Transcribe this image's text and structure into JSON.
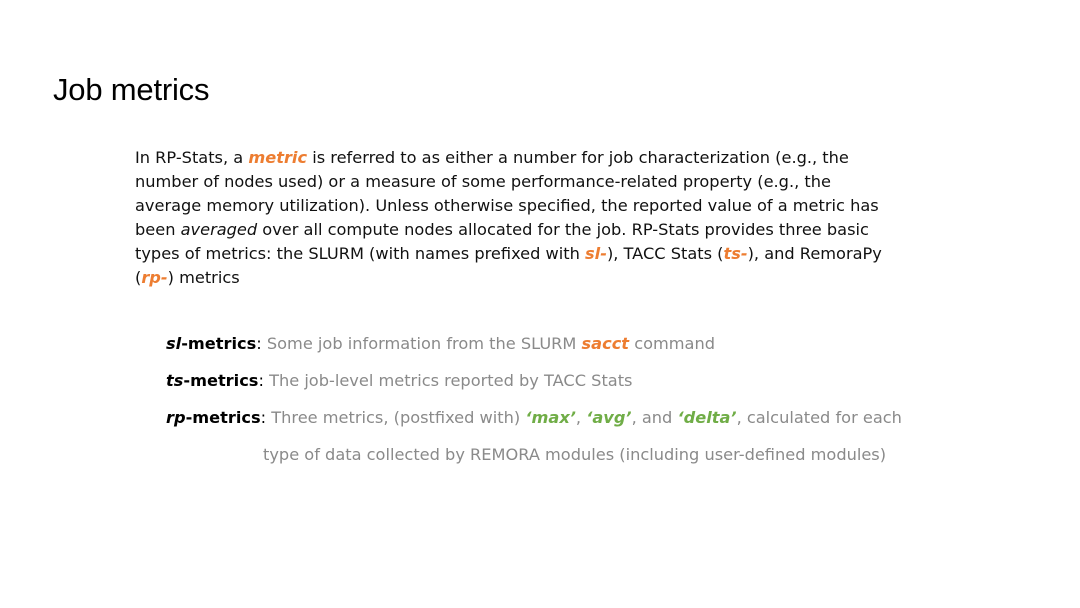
{
  "slide": {
    "title": "Job metrics",
    "paragraph": {
      "l1a": "In RP-Stats, a ",
      "l1_metric": "metric",
      "l1b": " is referred to as either a number for job characterization (e.g., the",
      "l2": "number of nodes used) or a measure of some performance-related property (e.g., the",
      "l3": "average memory utilization). Unless otherwise specified, the reported value of a metric has",
      "l4a": "been ",
      "l4_averaged": "averaged",
      "l4b": " over all compute nodes allocated for the job. RP-Stats provides three basic",
      "l5a": "types of metrics: the SLURM (with names prefixed with ",
      "l5_sl": "sl-",
      "l5b": "), TACC Stats (",
      "l5_ts": "ts-",
      "l5c": "), and RemoraPy",
      "l6a": "(",
      "l6_rp": "rp-",
      "l6b": ") metrics"
    },
    "items": [
      {
        "prefix": "sl",
        "suffix": "-metrics",
        "colon": ": ",
        "text_a": "Some job information from the SLURM ",
        "highlight": "sacct",
        "text_b": " command"
      },
      {
        "prefix": "ts",
        "suffix": "-metrics",
        "colon": ": ",
        "text": "The job-level metrics reported by TACC Stats"
      },
      {
        "prefix": "rp",
        "suffix": "-metrics",
        "colon": ": ",
        "text_a": "Three metrics, (postfixed with) ",
        "max": "‘max’",
        "sep1": ", ",
        "avg": "‘avg’",
        "sep2": ", and ",
        "delta": "‘delta’",
        "text_b": ", calculated for each",
        "continuation": "type of data collected by REMORA modules (including user-defined modules)"
      }
    ]
  },
  "colors": {
    "accent_orange": "#ed7d31",
    "accent_green": "#70ad47",
    "body_gray": "#8a8a8a"
  }
}
